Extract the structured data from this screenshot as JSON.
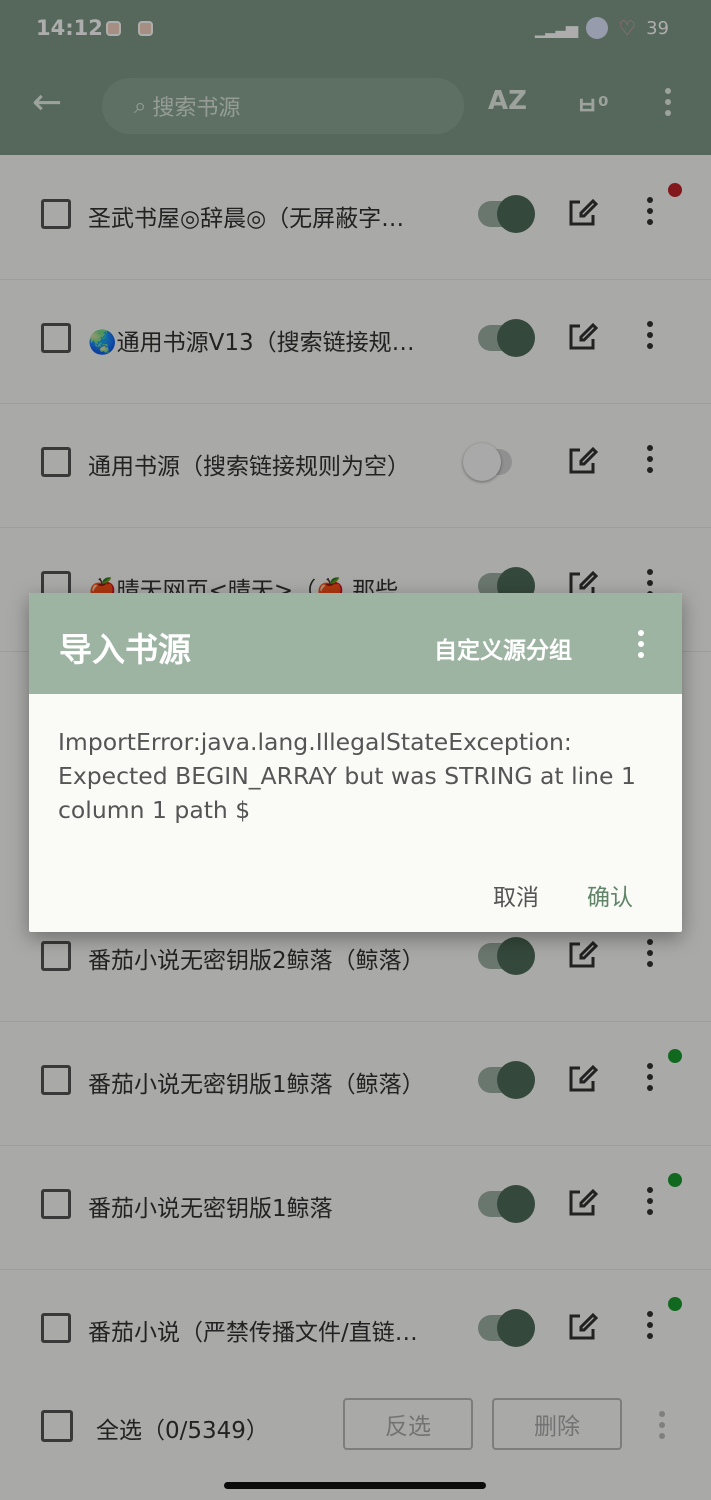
{
  "status_bar": {
    "time": "14:12",
    "battery": "39"
  },
  "toolbar": {
    "search_placeholder": "搜索书源",
    "sort_label": "AZ",
    "back_icon": "arrow-left-icon",
    "group_icon": "group-icon",
    "more_icon": "more-vertical-icon"
  },
  "sources": [
    {
      "title": "圣武书屋◎辞晨◎（无屏蔽字…",
      "enabled": true,
      "dot": "#c0242a"
    },
    {
      "title": "🌏通用书源V13（搜索链接规…",
      "enabled": true,
      "dot": null
    },
    {
      "title": "通用书源（搜索链接规则为空）",
      "enabled": false,
      "dot": null
    },
    {
      "title": "🍎晴天网页<晴天>（🍎 那些…",
      "enabled": true,
      "dot": null
    },
    {
      "title": "番茄小说无密钥版2鲸落（鲸落）",
      "enabled": true,
      "dot": "#1a9a2e"
    },
    {
      "title": "番茄小说无密钥版1鲸落（鲸落）",
      "enabled": true,
      "dot": "#1a9a2e"
    },
    {
      "title": "番茄小说无密钥版1鲸落",
      "enabled": true,
      "dot": "#1a9a2e"
    },
    {
      "title": "番茄小说（严禁传播文件/直链…",
      "enabled": true,
      "dot": "#1a9a2e"
    }
  ],
  "bottom_bar": {
    "select_all": "全选（0/5349）",
    "invert": "反选",
    "delete": "删除"
  },
  "dialog": {
    "title": "导入书源",
    "custom_group": "自定义源分组",
    "message": "ImportError:java.lang.IllegalStateException: Expected BEGIN_ARRAY but was STRING at line 1 column 1 path $",
    "cancel": "取消",
    "confirm": "确认"
  },
  "colors": {
    "accent": "#7e9a86",
    "dialog_header": "#9db4a3",
    "confirm_text": "#5f8468"
  }
}
